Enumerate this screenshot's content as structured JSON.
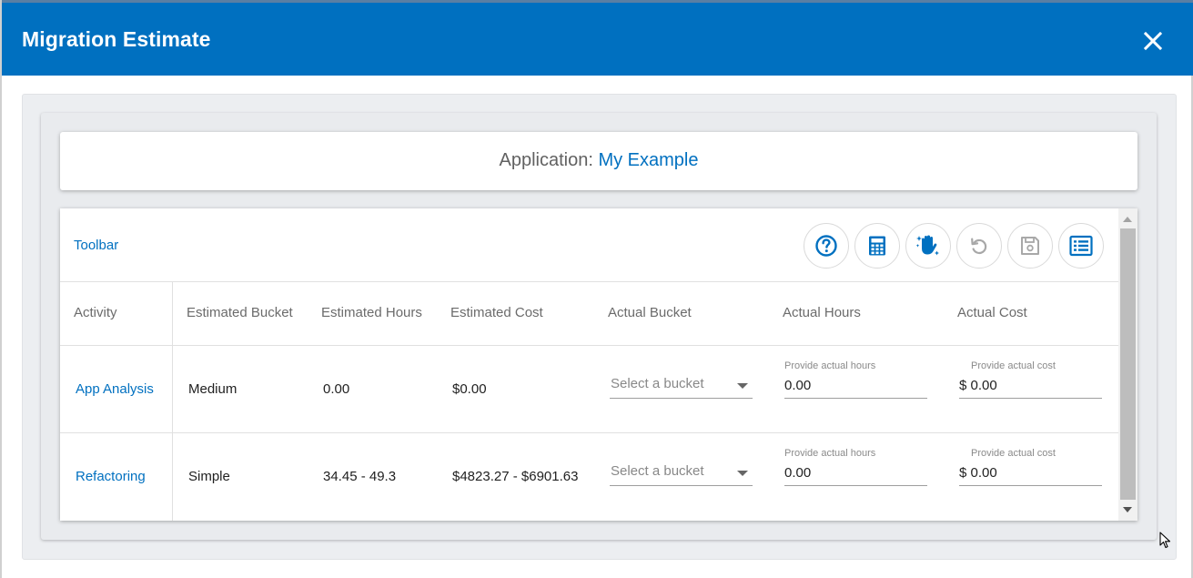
{
  "dialog": {
    "title": "Migration Estimate",
    "close_icon": "close-icon"
  },
  "application": {
    "label": "Application:",
    "name": "My Example"
  },
  "toolbar": {
    "label": "Toolbar",
    "buttons": [
      {
        "icon": "help-icon"
      },
      {
        "icon": "calculator-icon"
      },
      {
        "icon": "hand-sparkle-icon"
      },
      {
        "icon": "undo-icon"
      },
      {
        "icon": "save-icon"
      },
      {
        "icon": "list-view-icon"
      }
    ]
  },
  "table": {
    "columns": [
      "Activity",
      "Estimated Bucket",
      "Estimated Hours",
      "Estimated Cost",
      "Actual Bucket",
      "Actual Hours",
      "Actual Cost"
    ],
    "rows": [
      {
        "activity": "App Analysis",
        "estimated_bucket": "Medium",
        "estimated_hours": "0.00",
        "estimated_cost": "$0.00",
        "actual_bucket_placeholder": "Select a bucket",
        "actual_hours_label": "Provide actual hours",
        "actual_hours_value": "0.00",
        "actual_cost_label": "Provide actual cost",
        "actual_cost_value": "$ 0.00"
      },
      {
        "activity": "Refactoring",
        "estimated_bucket": "Simple",
        "estimated_hours": "34.45 - 49.3",
        "estimated_cost": "$4823.27 - $6901.63",
        "actual_bucket_placeholder": "Select a bucket",
        "actual_hours_label": "Provide actual hours",
        "actual_hours_value": "0.00",
        "actual_cost_label": "Provide actual cost",
        "actual_cost_value": "$ 0.00"
      }
    ]
  },
  "colors": {
    "header": "#0070c0",
    "link": "#0070c0",
    "panel": "#eceef1"
  }
}
